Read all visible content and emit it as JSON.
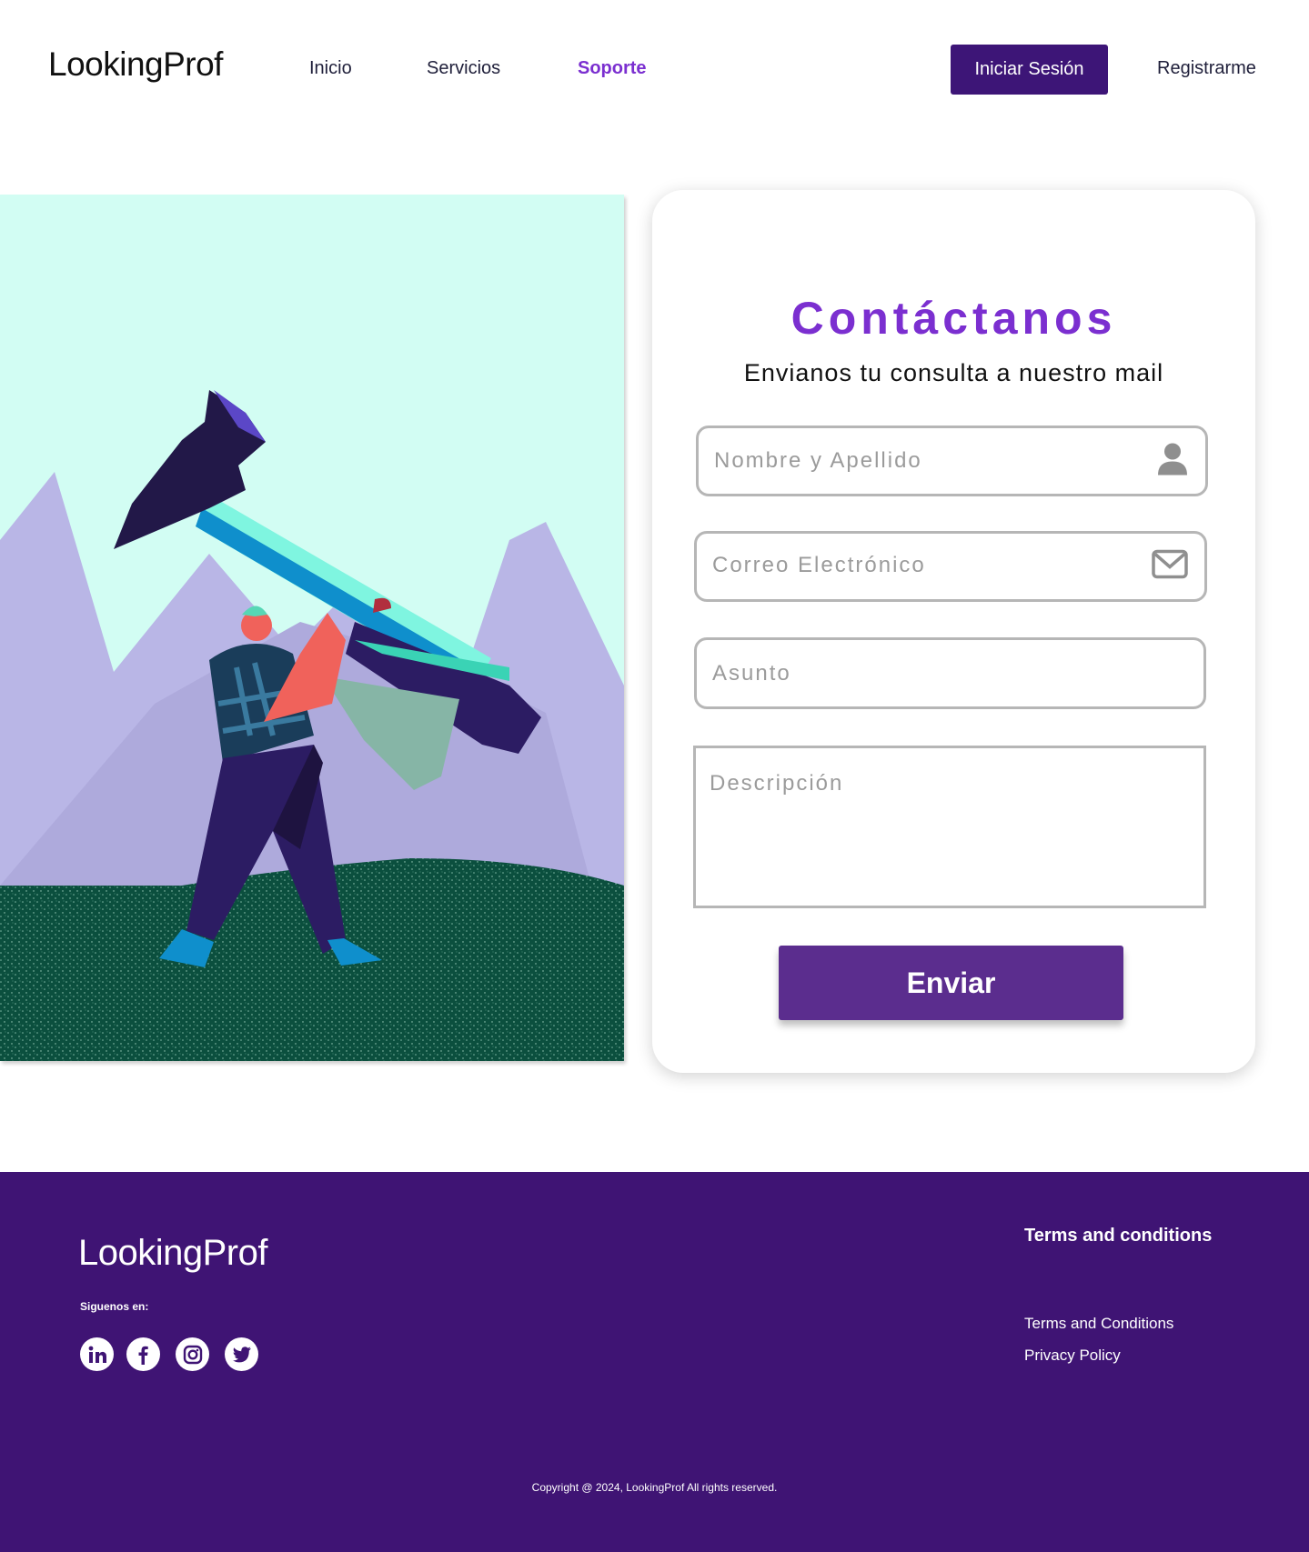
{
  "header": {
    "logo": "LookingProf",
    "nav": [
      "Inicio",
      "Servicios",
      "Soporte"
    ],
    "login_label": "Iniciar Sesión",
    "register_label": "Registrarme"
  },
  "contact": {
    "title": "Contáctanos",
    "subtitle": "Envianos tu consulta a nuestro mail",
    "name_placeholder": "Nombre y Apellido",
    "email_placeholder": "Correo Electrónico",
    "subject_placeholder": "Asunto",
    "description_placeholder": "Descripción",
    "send_label": "Enviar"
  },
  "footer": {
    "logo": "LookingProf",
    "follow_label": "Siguenos en:",
    "social": [
      "linkedin-icon",
      "facebook-icon",
      "instagram-icon",
      "twitter-icon"
    ],
    "terms_title": "Terms and conditions",
    "terms_link": "Terms and Conditions",
    "privacy_link": "Privacy Policy",
    "copyright": "Copyright @ 2024, LookingProf All rights reserved."
  },
  "colors": {
    "brand_purple": "#3f1474",
    "accent_purple": "#7b2fd0",
    "button_purple": "#5b2d8e"
  }
}
